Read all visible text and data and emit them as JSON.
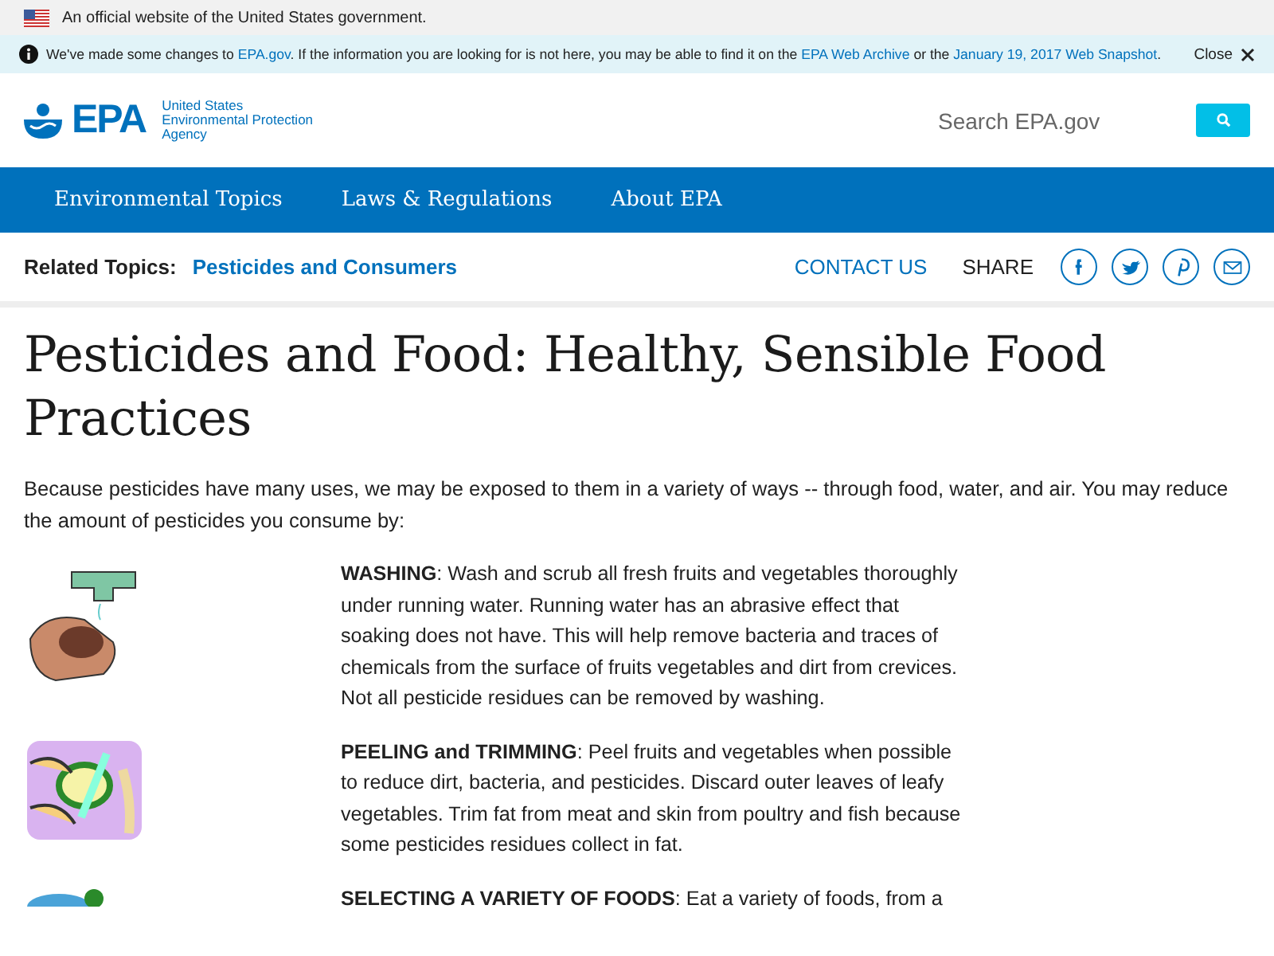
{
  "gov_banner": {
    "text": "An official website of the United States government."
  },
  "notice": {
    "parts": [
      {
        "kind": "text",
        "text": "We've made some changes to"
      },
      {
        "kind": "link",
        "text": "EPA.gov"
      },
      {
        "kind": "text",
        "text": ". If the information you are looking for is not here, you may be able to find it on the"
      },
      {
        "kind": "link",
        "text": "EPA Web Archive"
      },
      {
        "kind": "text",
        "text": "or the"
      },
      {
        "kind": "link",
        "text": "January 19, 2017 Web Snapshot"
      },
      {
        "kind": "text",
        "text": "."
      }
    ],
    "close": "Close"
  },
  "header": {
    "logo": "EPA",
    "agency": [
      "United States",
      "Environmental Protection",
      "Agency"
    ],
    "search": {
      "placeholder": "Search EPA.gov"
    }
  },
  "nav": [
    "Environmental Topics",
    "Laws & Regulations",
    "About EPA"
  ],
  "related": {
    "label": "Related Topics:",
    "link": "Pesticides and Consumers",
    "contact": "CONTACT US",
    "share": "SHARE"
  },
  "title": "Pesticides and Food: Healthy, Sensible Food Practices",
  "intro": "Because pesticides have many uses, we may be exposed to them in a variety of ways -- through food, water, and air. You may reduce the amount of pesticides you consume by:",
  "items": [
    {
      "kind": "washing",
      "text": "**WASHING**: Wash and scrub all fresh fruits and vegetables thoroughly under running water. Running water has an abrasive effect that soaking does not have. This will help remove bacteria and traces of chemicals from the surface of fruits vegetables and dirt from crevices. Not all pesticide residues can be removed by washing."
    },
    {
      "kind": "peeling",
      "text": "**PEELING and TRIMMING**: Peel fruits and vegetables when possible to reduce dirt, bacteria, and pesticides. Discard outer leaves of leafy vegetables. Trim fat from meat and skin from poultry and fish because some pesticides residues collect in fat."
    },
    {
      "kind": "variety",
      "text": "**SELECTING A VARIETY OF FOODS**: Eat a variety of foods, from a"
    }
  ]
}
